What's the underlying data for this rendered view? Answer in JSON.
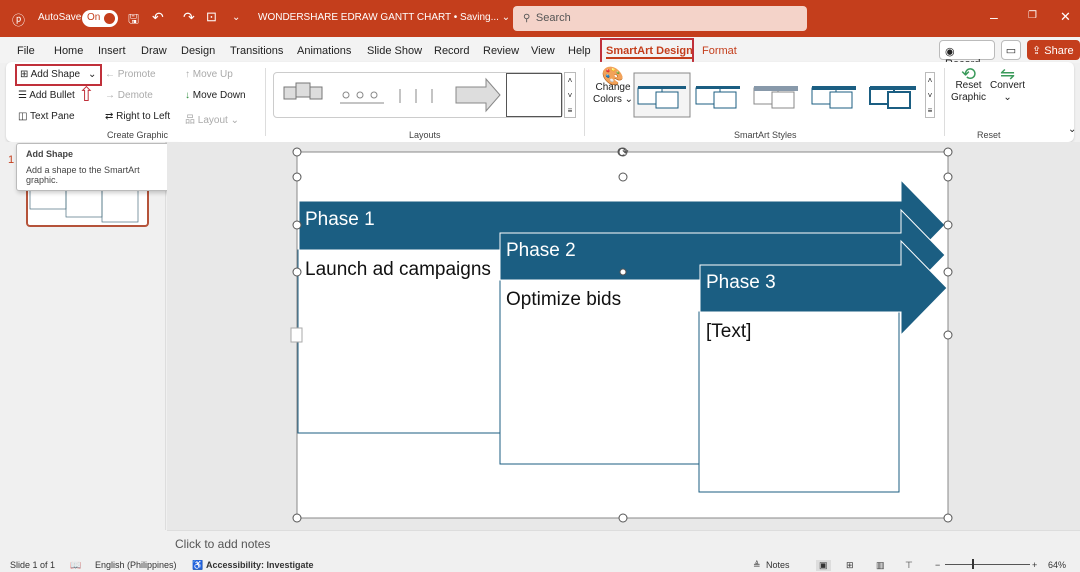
{
  "titlebar": {
    "autosave": "AutoSave",
    "toggle": "On",
    "doc_title": "WONDERSHARE EDRAW GANTT CHART • Saving... ⌄",
    "search_placeholder": "Search"
  },
  "menu": {
    "tabs": [
      "File",
      "Home",
      "Insert",
      "Draw",
      "Design",
      "Transitions",
      "Animations",
      "Slide Show",
      "Record",
      "Review",
      "View",
      "Help",
      "SmartArt Design",
      "Format"
    ],
    "record": "Record",
    "share": "Share"
  },
  "ribbon": {
    "add_shape": "Add Shape",
    "add_bullet": "Add Bullet",
    "text_pane": "Text Pane",
    "promote": "Promote",
    "demote": "Demote",
    "right_to_left": "Right to Left",
    "move_up": "Move Up",
    "move_down": "Move Down",
    "layout": "Layout",
    "group_create": "Create Graphic",
    "group_layouts": "Layouts",
    "change_colors": "Change",
    "change_colors2": "Colors ⌄",
    "group_styles": "SmartArt Styles",
    "reset_graphic": "Reset",
    "reset_graphic2": "Graphic",
    "convert": "Convert",
    "group_reset": "Reset"
  },
  "tooltip": {
    "title": "Add Shape",
    "body": "Add a shape to the SmartArt graphic."
  },
  "thumb": {
    "number": "1"
  },
  "smartart": {
    "phases": [
      {
        "title": "Phase 1",
        "text": "Launch ad campaigns"
      },
      {
        "title": "Phase 2",
        "text": "Optimize bids"
      },
      {
        "title": "Phase 3",
        "text": "[Text]"
      }
    ],
    "color": "#1b5e82"
  },
  "notes": {
    "placeholder": "Click to add notes"
  },
  "status": {
    "slide": "Slide 1 of 1",
    "language": "English (Philippines)",
    "accessibility": "Accessibility: Investigate",
    "notes": "Notes",
    "zoom": "64%"
  },
  "colors": {
    "brand": "#c43e1c",
    "highlight": "#c0303a"
  }
}
